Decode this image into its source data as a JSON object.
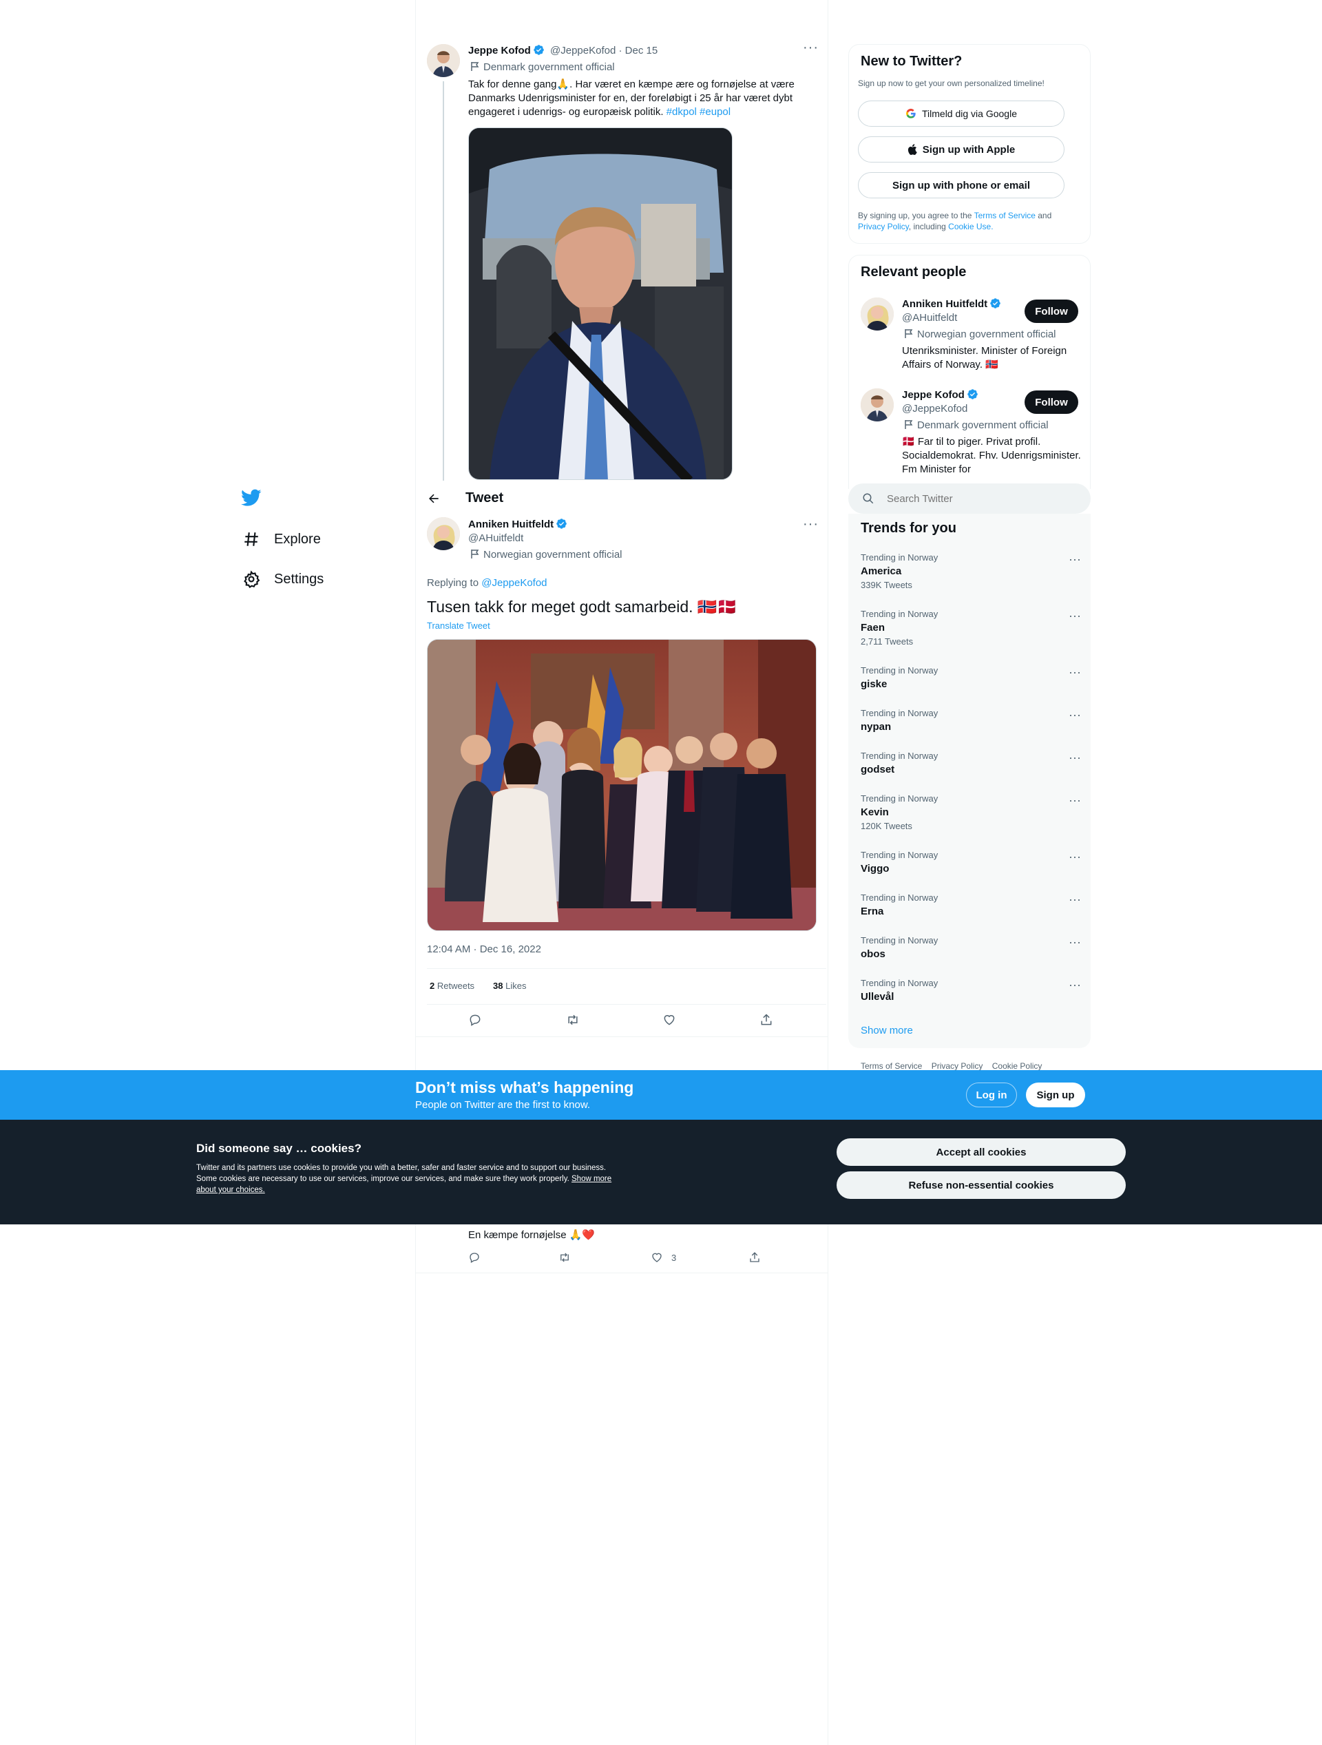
{
  "sidebar": {
    "nav": [
      {
        "label": "Explore",
        "icon": "hashtag-icon"
      },
      {
        "label": "Settings",
        "icon": "gear-icon"
      }
    ]
  },
  "parent_tweet": {
    "name": "Jeppe Kofod",
    "handle": "@JeppeKofod",
    "date": "· Dec 15",
    "label": "Denmark government official",
    "text_plain": "Tak for denne gang🙏. Har været en kæmpe ære og fornøjelse at være Danmarks Udenrigsminister for en, der foreløbigt i 25 år har været dybt engageret i udenrigs- og europæisk politik. ",
    "hashtags": [
      "#dkpol",
      "#eupol"
    ]
  },
  "header": {
    "title": "Tweet"
  },
  "main_tweet": {
    "name": "Anniken Huitfeldt",
    "handle": "@AHuitfeldt",
    "label": "Norwegian government official",
    "replying_prefix": "Replying to",
    "replying_to": "@JeppeKofod",
    "text": "Tusen takk for meget godt samarbeid. 🇳🇴🇩🇰",
    "translate": "Translate Tweet",
    "timestamp": "12:04 AM · Dec 16, 2022",
    "retweets_count": "2",
    "retweets_label": "Retweets",
    "likes_count": "38",
    "likes_label": "Likes"
  },
  "reply": {
    "text": "En kæmpe fornøjelse 🙏❤️",
    "likes": "3"
  },
  "signup": {
    "title": "New to Twitter?",
    "subtitle": "Sign up now to get your own personalized timeline!",
    "google": "Tilmeld dig via Google",
    "apple": "Sign up with Apple",
    "phone": "Sign up with phone or email",
    "legal_1": "By signing up, you agree to the ",
    "tos": "Terms of Service",
    "legal_2": " and ",
    "privacy": "Privacy Policy",
    "legal_3": ", including ",
    "cookie": "Cookie Use."
  },
  "relevant": {
    "title": "Relevant people",
    "people": [
      {
        "name": "Anniken Huitfeldt",
        "handle": "@AHuitfeldt",
        "label": "Norwegian government official",
        "bio": "Utenriksminister. Minister of Foreign Affairs of Norway. 🇳🇴",
        "button": "Follow"
      },
      {
        "name": "Jeppe Kofod",
        "handle": "@JeppeKofod",
        "label": "Denmark government official",
        "bio": "🇩🇰 Far til to piger. Privat profil. Socialdemokrat. Fhv. Udenrigsminister. Fm Minister for",
        "button": "Follow"
      }
    ]
  },
  "search": {
    "placeholder": "Search Twitter"
  },
  "trends": {
    "title": "Trends for you",
    "items": [
      {
        "meta": "Trending in Norway",
        "name": "America",
        "count": "339K Tweets"
      },
      {
        "meta": "Trending in Norway",
        "name": "Faen",
        "count": "2,711 Tweets"
      },
      {
        "meta": "Trending in Norway",
        "name": "giske",
        "count": ""
      },
      {
        "meta": "Trending in Norway",
        "name": "nypan",
        "count": ""
      },
      {
        "meta": "Trending in Norway",
        "name": "godset",
        "count": ""
      },
      {
        "meta": "Trending in Norway",
        "name": "Kevin",
        "count": "120K Tweets"
      },
      {
        "meta": "Trending in Norway",
        "name": "Viggo",
        "count": ""
      },
      {
        "meta": "Trending in Norway",
        "name": "Erna",
        "count": ""
      },
      {
        "meta": "Trending in Norway",
        "name": "obos",
        "count": ""
      },
      {
        "meta": "Trending in Norway",
        "name": "Ullevål",
        "count": ""
      }
    ],
    "show_more": "Show more"
  },
  "footer_links": [
    "Terms of Service",
    "Privacy Policy",
    "Cookie Policy"
  ],
  "banner": {
    "title": "Don’t miss what’s happening",
    "subtitle": "People on Twitter are the first to know.",
    "login": "Log in",
    "signup": "Sign up"
  },
  "cookies": {
    "title": "Did someone say … cookies?",
    "body": "Twitter and its partners use cookies to provide you with a better, safer and faster service and to support our business. Some cookies are necessary to use our services, improve our services, and make sure they work properly. ",
    "link": "Show more about your choices.",
    "accept": "Accept all cookies",
    "refuse": "Refuse non-essential cookies"
  },
  "colors": {
    "accent": "#1d9bf0",
    "dark": "#0f1419",
    "muted": "#536471",
    "banner": "#1d9bf0",
    "cookie_bg": "#15202b"
  }
}
